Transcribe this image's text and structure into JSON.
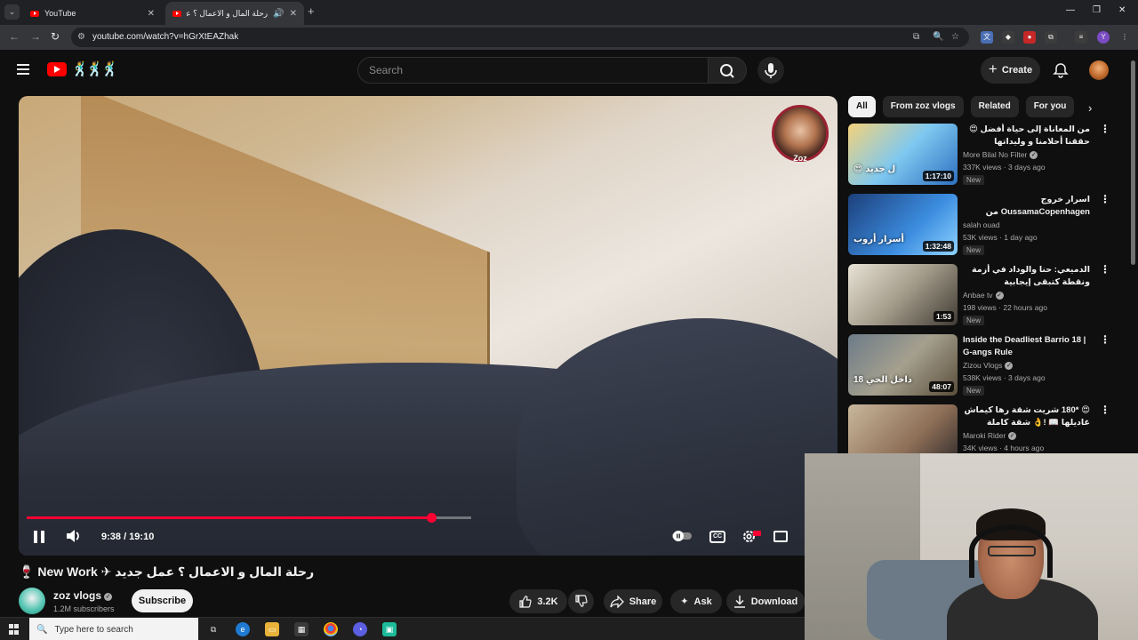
{
  "browser": {
    "tabs": [
      {
        "title": "YouTube",
        "active": false
      },
      {
        "title": "رحلة المال و الاعمال ؟ عمل ج...",
        "active": true
      }
    ],
    "url": "youtube.com/watch?v=hGrXtEAZhak"
  },
  "youtube": {
    "search_placeholder": "Search",
    "create_label": "Create"
  },
  "player": {
    "time_display": "9:38 / 19:10",
    "progress": 0.91,
    "channel_watermark": "Zoz"
  },
  "video": {
    "title": "رحلة المال و الاعمال ؟ عمل جديد ✈ New Work 🍷",
    "channel_name": "zoz vlogs",
    "subscribers": "1.2M subscribers",
    "subscribe_label": "Subscribe",
    "likes": "3.2K",
    "share_label": "Share",
    "ask_label": "Ask",
    "download_label": "Download"
  },
  "sidebar": {
    "chips": [
      "All",
      "From zoz vlogs",
      "Related",
      "For you"
    ],
    "recommendations": [
      {
        "title": "من المعاناة إلى حياة أفضل 😍 حققنا أحلامنا و وليداتها داكشي لي كانت كاحلم بيه",
        "channel": "More Bilal No Filter",
        "meta": "337K views · 3 days ago",
        "badge": "New",
        "duration": "1:17:10",
        "thumb_text": "ل جديد 😍"
      },
      {
        "title": "اسرار خروج OussamaCopenhagen من الفن..",
        "channel": "salah ouad",
        "meta": "53K views · 1 day ago",
        "badge": "New",
        "duration": "1:32:48",
        "thumb_text": "أسرار أروب"
      },
      {
        "title": "الدميعي: حنا والوداد في أزمة ونقطة كتبقى إيجابية",
        "channel": "Anbae tv",
        "meta": "198 views · 22 hours ago",
        "badge": "New",
        "duration": "1:53",
        "thumb_text": ""
      },
      {
        "title": "Inside the Deadliest Barrio 18 | G-angs Rule",
        "channel": "Zizou Vlogs",
        "meta": "538K views · 3 days ago",
        "badge": "New",
        "duration": "48:07",
        "thumb_text": "داخل الحي 18"
      },
      {
        "title": "😍 *180 شريت شقة رها كيماش غاديلها 📖 !👌 شقة كاملة ويشدال Renovation",
        "channel": "Maroki Rider",
        "meta": "34K views · 4 hours ago",
        "badge": "",
        "duration": "",
        "thumb_text": ""
      }
    ]
  },
  "taskbar": {
    "search_placeholder": "Type here to search"
  }
}
